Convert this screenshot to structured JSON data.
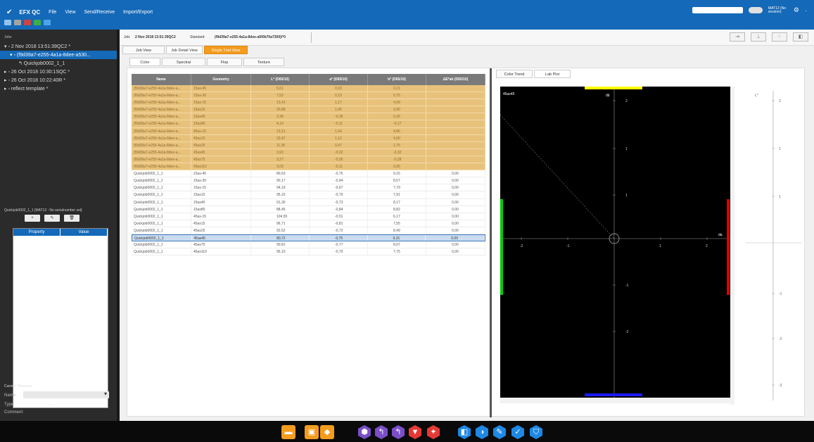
{
  "app": {
    "title": "EFX QC",
    "menu": [
      "File",
      "View",
      "Send/Receive",
      "Import/Export"
    ],
    "user": "MAT12 (No session)"
  },
  "left": {
    "header": "Jobs",
    "tree": [
      {
        "label": "▾ ◦ 2 Nov 2018 13:51:39QC2 *",
        "level": 0,
        "selected": false
      },
      {
        "label": "▾ ◦ (f9d39a7-e255-4a1a-8dee-a530...",
        "level": 1,
        "selected": true
      },
      {
        "label": "↰ Quickjob0002_1_1",
        "level": 2,
        "selected": false
      },
      {
        "label": "▸ ◦ 26 Oct 2018 10:30:1SQC *",
        "level": 0,
        "selected": false
      },
      {
        "label": "▸ ◦ 26 Oct 2018 10:22:40R *",
        "level": 0,
        "selected": false
      },
      {
        "label": "▸ ◦ reflect template *",
        "level": 0,
        "selected": false
      }
    ],
    "properties_title": "Quickjob0002_1_1 [MAT12 : No serialnumber set]",
    "prop_buttons": [
      "+",
      "✎",
      "🗑"
    ],
    "prop_columns": [
      "Property",
      "Value"
    ],
    "tolerance": {
      "title": "Current Tolerance",
      "name_label": "Name:",
      "type_label": "Type:",
      "type_value": "-",
      "comment_label": "Comment:"
    }
  },
  "jobbar": {
    "job_label": "Job:",
    "job_value": "2 Nov 2018 13:51:39QC2",
    "standard_label": "Standard:",
    "standard_value": "(f9d39a7-e255-4a1a-8dee-a5f0b70a7300)/*0"
  },
  "tabs": {
    "views": [
      "Job View",
      "Job Detail View",
      "Single Trial View"
    ],
    "active_view": 1,
    "highlight_view": 2,
    "sub": [
      "Color",
      "Spectral",
      "Flop",
      "Texture"
    ],
    "active_sub": 0,
    "right": [
      "Color Trend",
      "Lab Plot"
    ],
    "active_right": 1
  },
  "table": {
    "columns": [
      "Name",
      "Geometry",
      "L* (D65/10)",
      "a* (D65/10)",
      "b* (D65/10)",
      "ΔE*ab (D65/10)"
    ],
    "rows": [
      {
        "name": "(f9d39a7-e255-4a1a-8dee-a...",
        "geometry": "15as-45",
        "L": "5,61",
        "a": "0,03",
        "b": "0,21",
        "dE": "",
        "type": "std"
      },
      {
        "name": "(f9d39a7-e255-4a1a-8dee-a...",
        "geometry": "15as-30",
        "L": "7,53",
        "a": "0,23",
        "b": "0,75",
        "dE": "",
        "type": "std"
      },
      {
        "name": "(f9d39a7-e255-4a1a-8dee-a...",
        "geometry": "15as-15",
        "L": "13,41",
        "a": "1,17",
        "b": "4,09",
        "dE": "",
        "type": "std"
      },
      {
        "name": "(f9d39a7-e255-4a1a-8dee-a...",
        "geometry": "15as15",
        "L": "20,88",
        "a": "1,06",
        "b": "3,90",
        "dE": "",
        "type": "std"
      },
      {
        "name": "(f9d39a7-e255-4a1a-8dee-a...",
        "geometry": "15as45",
        "L": "3,38",
        "a": "-0,38",
        "b": "0,35",
        "dE": "",
        "type": "std"
      },
      {
        "name": "(f9d39a7-e255-4a1a-8dee-a...",
        "geometry": "15as80",
        "L": "4,19",
        "a": "-0,11",
        "b": "-0,17",
        "dE": "",
        "type": "std"
      },
      {
        "name": "(f9d39a7-e255-4a1a-8dee-a...",
        "geometry": "45as-15",
        "L": "13,21",
        "a": "1,54",
        "b": "4,86",
        "dE": "",
        "type": "std"
      },
      {
        "name": "(f9d39a7-e255-4a1a-8dee-a...",
        "geometry": "45as15",
        "L": "23,47",
        "a": "1,12",
        "b": "4,00",
        "dE": "",
        "type": "std"
      },
      {
        "name": "(f9d39a7-e255-4a1a-8dee-a...",
        "geometry": "45as25",
        "L": "11,35",
        "a": "0,47",
        "b": "1,75",
        "dE": "",
        "type": "std"
      },
      {
        "name": "(f9d39a7-e255-4a1a-8dee-a...",
        "geometry": "45as45",
        "L": "3,93",
        "a": "-0,02",
        "b": "-0,32",
        "dE": "",
        "type": "std"
      },
      {
        "name": "(f9d39a7-e255-4a1a-8dee-a...",
        "geometry": "45as75",
        "L": "3,27",
        "a": "-0,05",
        "b": "-0,28",
        "dE": "",
        "type": "std"
      },
      {
        "name": "(f9d39a7-e255-4a1a-8dee-a...",
        "geometry": "45as110",
        "L": "3,03",
        "a": "-0,11",
        "b": "0,05",
        "dE": "",
        "type": "std"
      },
      {
        "name": "Quickjob0002_1_1",
        "geometry": "15as-45",
        "L": "80,63",
        "a": "-0,75",
        "b": "9,15",
        "dE": "0,00",
        "type": "trial"
      },
      {
        "name": "Quickjob0002_1_1",
        "geometry": "15as-30",
        "L": "90,17",
        "a": "-0,94",
        "b": "8,57",
        "dE": "0,00",
        "type": "trial"
      },
      {
        "name": "Quickjob0002_1_1",
        "geometry": "15as-15",
        "L": "94,19",
        "a": "-0,67",
        "b": "7,79",
        "dE": "0,00",
        "type": "trial"
      },
      {
        "name": "Quickjob0002_1_1",
        "geometry": "15as15",
        "L": "95,15",
        "a": "-0,76",
        "b": "7,91",
        "dE": "0,00",
        "type": "trial"
      },
      {
        "name": "Quickjob0002_1_1",
        "geometry": "15as45",
        "L": "91,30",
        "a": "-0,73",
        "b": "8,17",
        "dE": "0,00",
        "type": "trial"
      },
      {
        "name": "Quickjob0002_1_1",
        "geometry": "15as80",
        "L": "88,45",
        "a": "-0,84",
        "b": "8,82",
        "dE": "0,00",
        "type": "trial"
      },
      {
        "name": "Quickjob0002_1_1",
        "geometry": "45as-15",
        "L": "104,55",
        "a": "-0,51",
        "b": "6,17",
        "dE": "0,00",
        "type": "trial"
      },
      {
        "name": "Quickjob0002_1_1",
        "geometry": "45as15",
        "L": "96,71",
        "a": "-0,81",
        "b": "7,55",
        "dE": "0,00",
        "type": "trial"
      },
      {
        "name": "Quickjob0002_1_1",
        "geometry": "45as25",
        "L": "92,62",
        "a": "-0,72",
        "b": "8,49",
        "dE": "0,00",
        "type": "trial"
      },
      {
        "name": "Quickjob0002_1_1",
        "geometry": "45as45",
        "L": "80,72",
        "a": "-0,75",
        "b": "9,31",
        "dE": "0,00",
        "type": "sel"
      },
      {
        "name": "Quickjob0002_1_1",
        "geometry": "45as75",
        "L": "90,81",
        "a": "-0,77",
        "b": "8,07",
        "dE": "0,00",
        "type": "trial"
      },
      {
        "name": "Quickjob0002_1_1",
        "geometry": "45as110",
        "L": "95,10",
        "a": "-0,79",
        "b": "7,75",
        "dE": "0,00",
        "type": "trial"
      }
    ]
  },
  "labplot": {
    "plot_label": "45as45",
    "x_axis_name": "da",
    "y_axis_name": "db",
    "x_ticks": [
      "-2",
      "-1",
      "1",
      "2"
    ],
    "y_ticks": [
      "2",
      "1",
      "1",
      "-1",
      "-2"
    ],
    "l_axis_name": "L*",
    "l_ticks": [
      "2",
      "1",
      "1",
      "-1",
      "-2",
      "-3"
    ],
    "colors": {
      "yellow": "#ffff00",
      "blue": "#1a1aff",
      "green": "#00cc00",
      "red": "#e00000",
      "axis": "#999999"
    }
  },
  "taskbar": {
    "icons": [
      {
        "name": "folder-icon",
        "color": "#f39c1e",
        "glyph": "▬"
      },
      {
        "name": "save-icon",
        "color": "#f39c1e",
        "glyph": "▣"
      },
      {
        "name": "tag-icon",
        "color": "#f39c1e",
        "glyph": "◆"
      },
      {
        "name": "measure-icon",
        "color": "#7a4fc9",
        "glyph": "⬢"
      },
      {
        "name": "trend-icon",
        "color": "#7a4fc9",
        "glyph": "↰"
      },
      {
        "name": "trend2-icon",
        "color": "#7a4fc9",
        "glyph": "↰"
      },
      {
        "name": "filter-icon",
        "color": "#e53935",
        "glyph": "▼"
      },
      {
        "name": "tools-icon",
        "color": "#e53935",
        "glyph": "✦"
      },
      {
        "name": "export-icon",
        "color": "#1e88e5",
        "glyph": "◧"
      },
      {
        "name": "import-icon",
        "color": "#1e88e5",
        "glyph": "◑"
      },
      {
        "name": "edit-icon",
        "color": "#1e88e5",
        "glyph": "✎"
      },
      {
        "name": "check-icon",
        "color": "#1e88e5",
        "glyph": "✓"
      },
      {
        "name": "shield-icon",
        "color": "#1e88e5",
        "glyph": "⛉"
      }
    ]
  }
}
